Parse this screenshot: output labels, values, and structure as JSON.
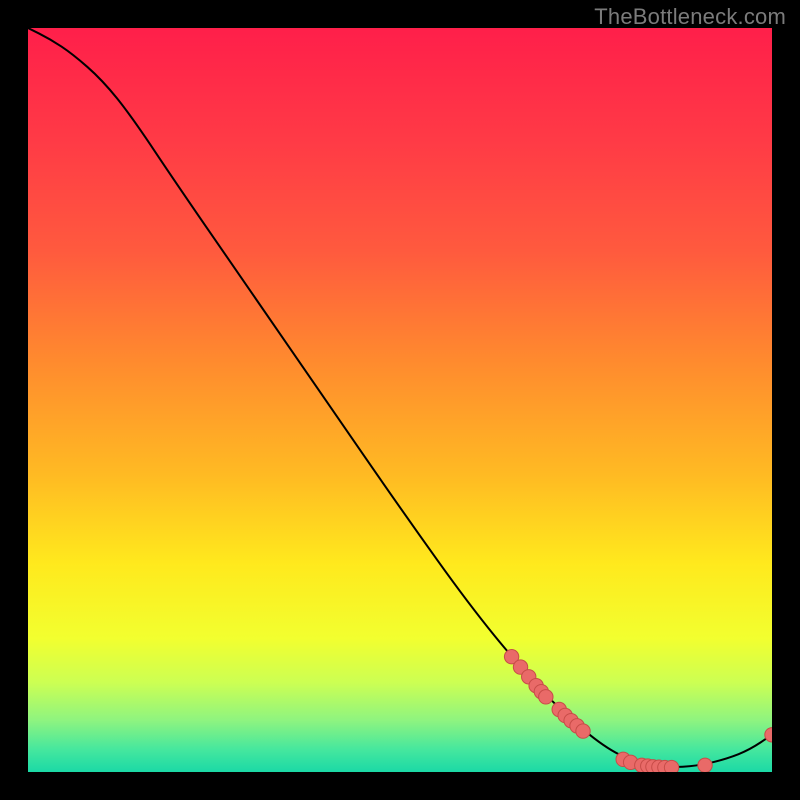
{
  "watermark": "TheBottleneck.com",
  "colors": {
    "gradient_stops": [
      {
        "offset": 0.0,
        "hex": "#ff1f4a"
      },
      {
        "offset": 0.15,
        "hex": "#ff3a46"
      },
      {
        "offset": 0.3,
        "hex": "#ff5a3e"
      },
      {
        "offset": 0.45,
        "hex": "#ff8b2e"
      },
      {
        "offset": 0.6,
        "hex": "#ffba23"
      },
      {
        "offset": 0.72,
        "hex": "#ffe91d"
      },
      {
        "offset": 0.82,
        "hex": "#f2ff2f"
      },
      {
        "offset": 0.88,
        "hex": "#ccff53"
      },
      {
        "offset": 0.93,
        "hex": "#8ff47f"
      },
      {
        "offset": 0.97,
        "hex": "#45e79e"
      },
      {
        "offset": 1.0,
        "hex": "#1bd9a6"
      }
    ],
    "curve": "#000000",
    "marker_fill": "#e96a68",
    "marker_stroke": "#c74c48"
  },
  "chart_data": {
    "type": "line",
    "title": "",
    "xlabel": "",
    "ylabel": "",
    "xlim": [
      0,
      100
    ],
    "ylim": [
      0,
      100
    ],
    "curve": [
      {
        "x": 0,
        "y": 100
      },
      {
        "x": 3,
        "y": 98.5
      },
      {
        "x": 6,
        "y": 96.5
      },
      {
        "x": 10,
        "y": 93
      },
      {
        "x": 14,
        "y": 88
      },
      {
        "x": 20,
        "y": 79
      },
      {
        "x": 30,
        "y": 64.5
      },
      {
        "x": 40,
        "y": 50
      },
      {
        "x": 50,
        "y": 35.5
      },
      {
        "x": 60,
        "y": 21.5
      },
      {
        "x": 68,
        "y": 12
      },
      {
        "x": 73,
        "y": 7
      },
      {
        "x": 78,
        "y": 3
      },
      {
        "x": 82,
        "y": 1.2
      },
      {
        "x": 86,
        "y": 0.6
      },
      {
        "x": 90,
        "y": 0.8
      },
      {
        "x": 94,
        "y": 1.8
      },
      {
        "x": 97,
        "y": 3
      },
      {
        "x": 100,
        "y": 5
      }
    ],
    "markers": [
      {
        "x": 65.0,
        "y": 15.5
      },
      {
        "x": 66.2,
        "y": 14.1
      },
      {
        "x": 67.3,
        "y": 12.8
      },
      {
        "x": 68.3,
        "y": 11.6
      },
      {
        "x": 69.0,
        "y": 10.8
      },
      {
        "x": 69.6,
        "y": 10.1
      },
      {
        "x": 71.4,
        "y": 8.4
      },
      {
        "x": 72.2,
        "y": 7.6
      },
      {
        "x": 73.0,
        "y": 6.9
      },
      {
        "x": 73.8,
        "y": 6.2
      },
      {
        "x": 74.6,
        "y": 5.5
      },
      {
        "x": 80.0,
        "y": 1.7
      },
      {
        "x": 81.0,
        "y": 1.3
      },
      {
        "x": 82.5,
        "y": 0.9
      },
      {
        "x": 83.3,
        "y": 0.8
      },
      {
        "x": 84.0,
        "y": 0.7
      },
      {
        "x": 84.8,
        "y": 0.65
      },
      {
        "x": 85.6,
        "y": 0.6
      },
      {
        "x": 86.5,
        "y": 0.6
      },
      {
        "x": 91.0,
        "y": 0.9
      },
      {
        "x": 100.0,
        "y": 5.0
      }
    ]
  }
}
